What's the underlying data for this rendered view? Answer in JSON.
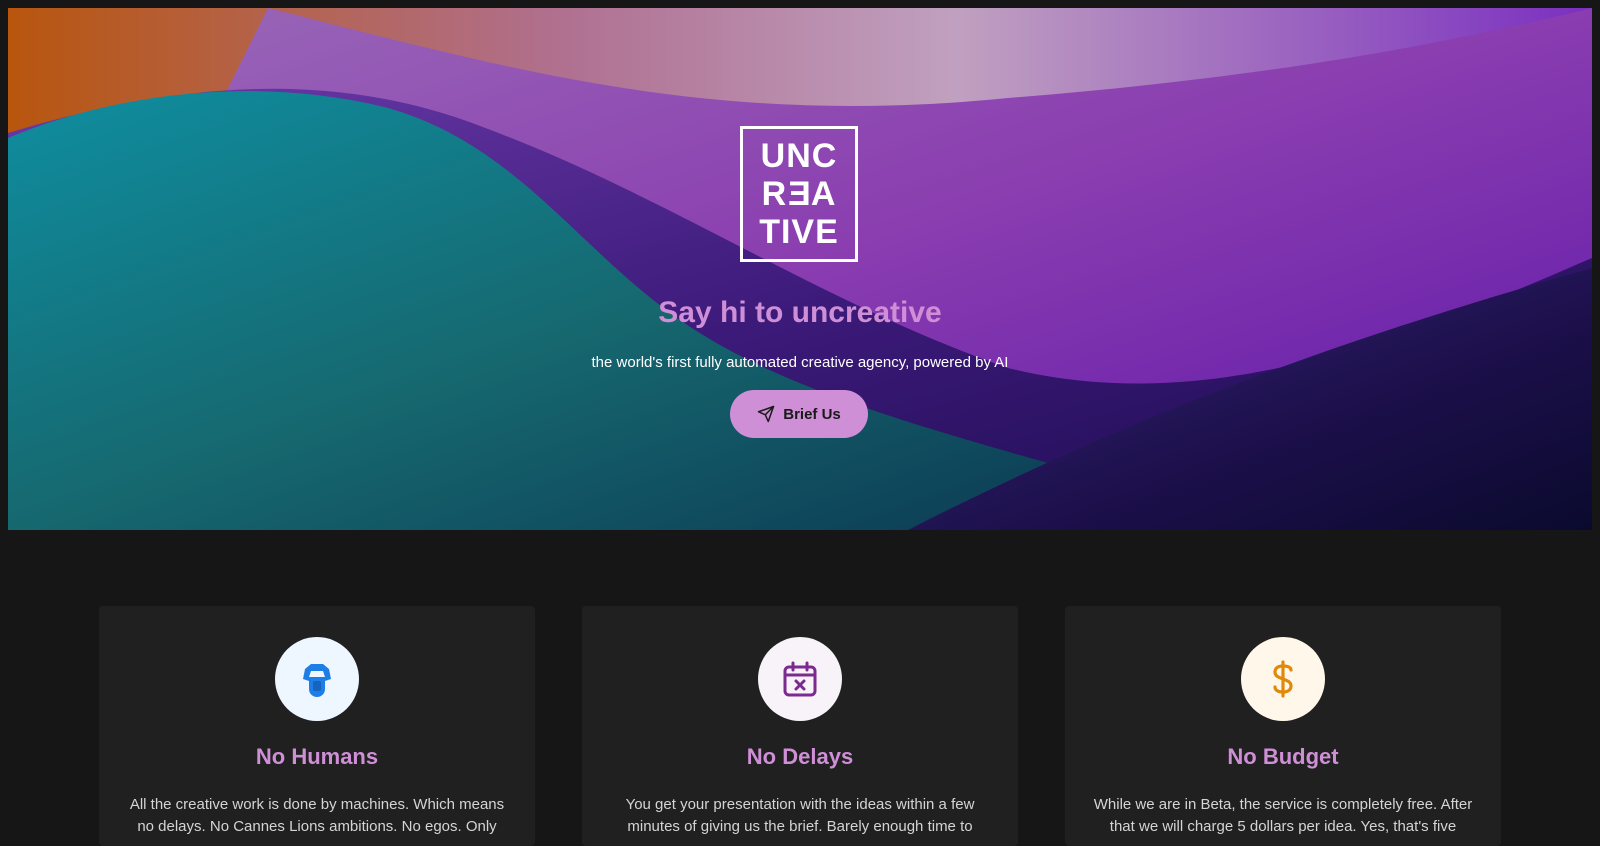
{
  "hero": {
    "logo_lines": [
      "UNC",
      "R",
      "E",
      "A",
      "TIVE"
    ],
    "title": "Say hi to uncreative",
    "subtitle": "the world's first fully automated creative agency, powered by AI",
    "cta_label": "Brief Us"
  },
  "features": [
    {
      "icon": "robot-head-icon",
      "icon_color": "#1e7ee6",
      "circle_bg": "#eef6ff",
      "title": "No Humans",
      "text": "All the creative work is done by machines. Which means no delays. No Cannes Lions ambitions. No egos. Only"
    },
    {
      "icon": "calendar-x-icon",
      "icon_color": "#7b2a8f",
      "circle_bg": "#f8f2f9",
      "title": "No Delays",
      "text": "You get your presentation with the ideas within a few minutes of giving us the brief. Barely enough time to"
    },
    {
      "icon": "dollar-icon",
      "icon_color": "#e08a0c",
      "circle_bg": "#fff8ea",
      "title": "No Budget",
      "text": "While we are in Beta, the service is completely free. After that we will charge 5 dollars per idea. Yes, that's five"
    }
  ],
  "colors": {
    "accent": "#cf8fd6",
    "page_bg": "#161616",
    "card_bg": "#202020"
  }
}
